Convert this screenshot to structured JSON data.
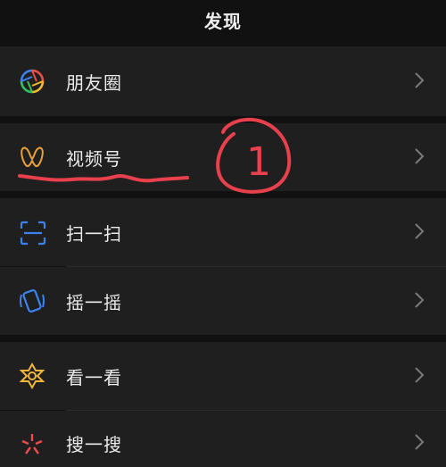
{
  "header": {
    "title": "发现"
  },
  "rows": [
    {
      "label": "朋友圈",
      "icon": "moments-icon"
    },
    {
      "label": "视频号",
      "icon": "channels-icon"
    },
    {
      "label": "扫一扫",
      "icon": "scan-icon"
    },
    {
      "label": "摇一摇",
      "icon": "shake-icon"
    },
    {
      "label": "看一看",
      "icon": "top-stories-icon"
    },
    {
      "label": "搜一搜",
      "icon": "search-icon"
    }
  ],
  "annotation": {
    "text": "1",
    "color": "#e8404c"
  },
  "colors": {
    "background": "#111111",
    "row": "#1f1f1f",
    "text": "#ececec",
    "chevron": "#7a7a7a"
  }
}
